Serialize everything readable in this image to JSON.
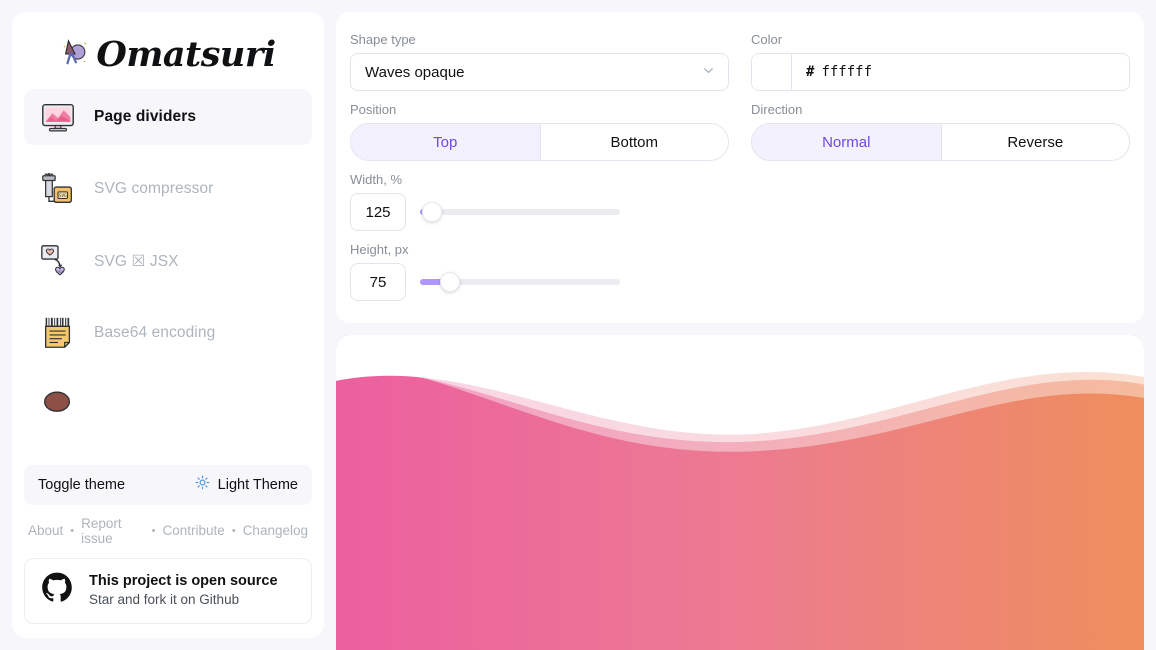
{
  "brand": {
    "name": "Omatsuri",
    "logo_icon": "festival-icon"
  },
  "sidebar": {
    "items": [
      {
        "label": "Page dividers",
        "icon": "monitor-icon",
        "active": true
      },
      {
        "label": "SVG compressor",
        "icon": "compressor-icon",
        "active": false
      },
      {
        "label": "SVG ☒ JSX",
        "icon": "svg-to-jsx-icon",
        "active": false
      },
      {
        "label": "Base64 encoding",
        "icon": "base64-note-icon",
        "active": false
      }
    ],
    "theme": {
      "toggle_label": "Toggle theme",
      "current_value": "Light Theme",
      "icon": "sun-icon"
    },
    "links": [
      {
        "label": "About"
      },
      {
        "label": "Report issue"
      },
      {
        "label": "Contribute"
      },
      {
        "label": "Changelog"
      }
    ],
    "links_separator": "•",
    "github": {
      "icon": "github-icon",
      "title": "This project is open source",
      "subtitle": "Star and fork it on Github"
    }
  },
  "controls": {
    "shape_type": {
      "label": "Shape type",
      "value": "Waves opaque",
      "chevron": "chevron-down-icon"
    },
    "color": {
      "label": "Color",
      "hash": "#",
      "value": "ffffff",
      "swatch_hex": "#ffffff"
    },
    "position": {
      "label": "Position",
      "options": [
        "Top",
        "Bottom"
      ],
      "selected": "Top"
    },
    "direction": {
      "label": "Direction",
      "options": [
        "Normal",
        "Reverse"
      ],
      "selected": "Normal"
    },
    "width": {
      "label": "Width, %",
      "value": "125",
      "percent": 6
    },
    "height": {
      "label": "Height, px",
      "value": "75",
      "percent": 15
    }
  },
  "preview": {
    "gradient_start": "#ec5f9f",
    "gradient_end": "#ef8e5c",
    "overlay_color": "#ffffff"
  },
  "accent": "#7048e8",
  "accent_soft": "#b197fc"
}
